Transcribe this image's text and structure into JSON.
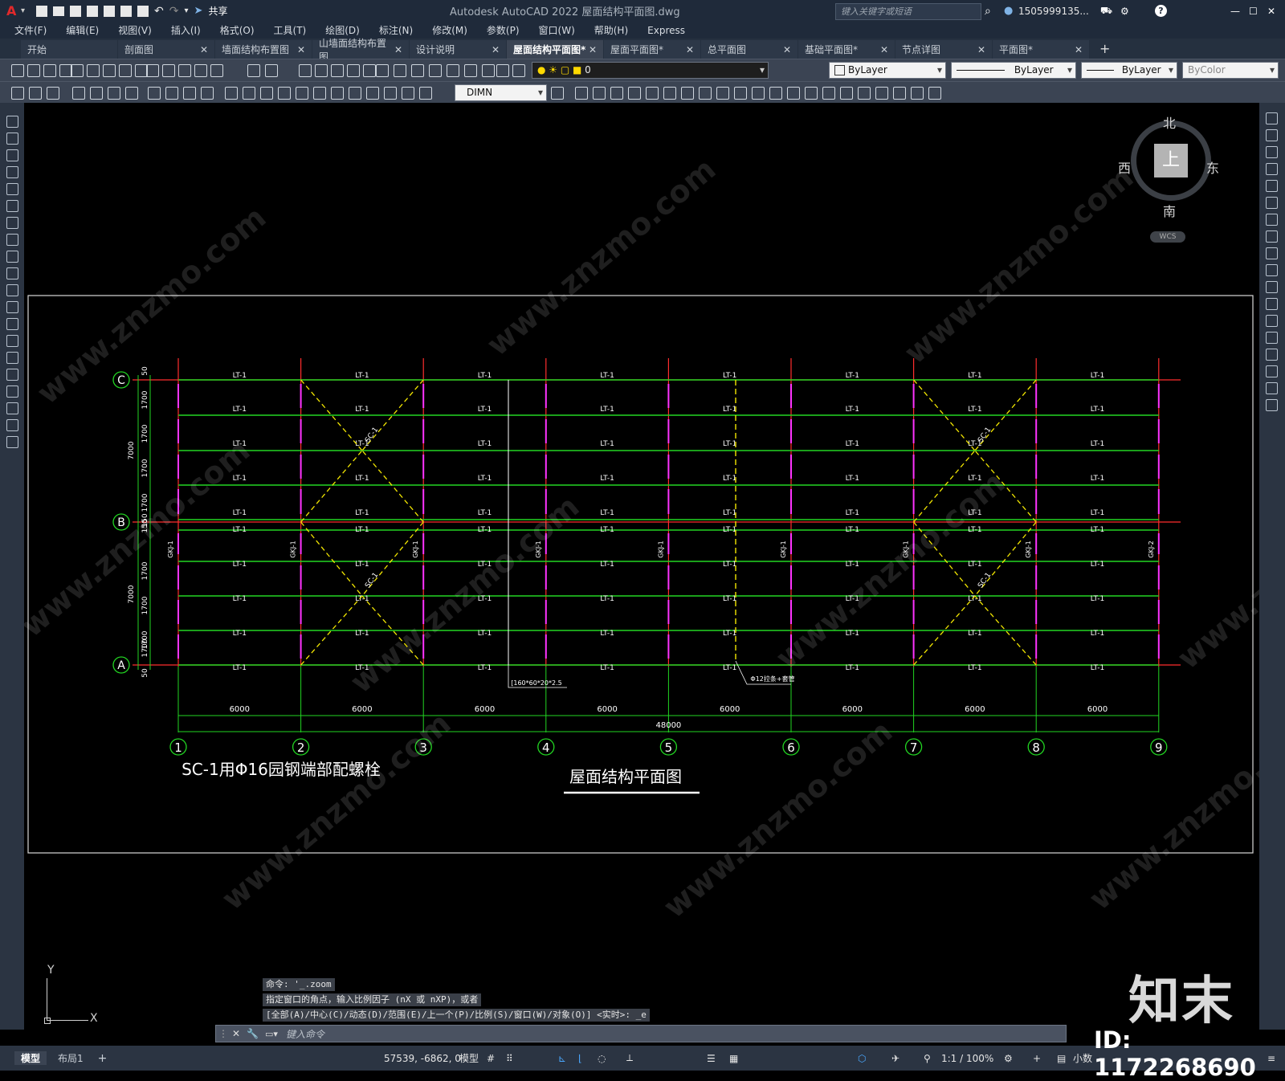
{
  "app": {
    "title": "Autodesk AutoCAD 2022    屋面结构平面图.dwg",
    "search_placeholder": "键入关键字或短语",
    "user": "1505999135...",
    "share": "共享",
    "logo": "A"
  },
  "menu": [
    "文件(F)",
    "编辑(E)",
    "视图(V)",
    "插入(I)",
    "格式(O)",
    "工具(T)",
    "绘图(D)",
    "标注(N)",
    "修改(M)",
    "参数(P)",
    "窗口(W)",
    "帮助(H)",
    "Express"
  ],
  "tabs": [
    {
      "label": "开始",
      "close": ""
    },
    {
      "label": "剖面图",
      "close": "✕"
    },
    {
      "label": "墙面结构布置图",
      "close": "✕"
    },
    {
      "label": "山墙面结构布置图",
      "close": "✕"
    },
    {
      "label": "设计说明",
      "close": "✕"
    },
    {
      "label": "屋面结构平面图*",
      "close": "✕"
    },
    {
      "label": "屋面平面图*",
      "close": "✕"
    },
    {
      "label": "总平面图",
      "close": "✕"
    },
    {
      "label": "基础平面图*",
      "close": "✕"
    },
    {
      "label": "节点详图",
      "close": "✕"
    },
    {
      "label": "平面图*",
      "close": "✕"
    }
  ],
  "active_tab": 5,
  "toolbar": {
    "layer_value": "0",
    "color": "ByLayer",
    "linetype": "ByLayer",
    "lineweight": "ByLayer",
    "plotstyle": "ByColor",
    "dimstyle": "DIMN"
  },
  "viewcube": {
    "north": "北",
    "south": "南",
    "east": "东",
    "west": "西",
    "top": "上",
    "wcs": "WCS"
  },
  "ucs": {
    "y": "Y",
    "x": "X"
  },
  "drawing": {
    "grid_cols": [
      "1",
      "2",
      "3",
      "4",
      "5",
      "6",
      "7",
      "8",
      "9"
    ],
    "grid_rows": [
      "C",
      "B",
      "A"
    ],
    "purlin_label": "LT-1",
    "brace_label": "SC-1",
    "bay_dims": [
      "6000",
      "6000",
      "6000",
      "6000",
      "6000",
      "6000",
      "6000",
      "6000"
    ],
    "total_dim": "48000",
    "left_dims_small": [
      "50",
      "1700",
      "1700",
      "1700",
      "1700",
      "150",
      "150",
      "1700",
      "1700",
      "1700",
      "1700",
      "50"
    ],
    "left_dims_big": [
      "7000",
      "7000"
    ],
    "gj_labels": [
      "GKJ-1",
      "GKJ-1",
      "GKJ-1",
      "GKJ-1",
      "GKJ-1",
      "GKJ-1",
      "GKJ-1",
      "GKJ-1",
      "GKJ-2"
    ],
    "note_tube": "[160*60*20*2.5",
    "note_rod": "Φ12拉条+套管",
    "note_sc": "SC-1用Φ16园钢端部配螺栓",
    "title": "屋面结构平面图"
  },
  "command": {
    "history": [
      "命令: '_.zoom",
      "指定窗口的角点，输入比例因子 (nX 或 nXP)，或者",
      "[全部(A)/中心(C)/动态(D)/范围(E)/上一个(P)/比例(S)/窗口(W)/对象(O)] <实时>: _e"
    ],
    "placeholder": "键入命令"
  },
  "status": {
    "layout_tabs": [
      "模型",
      "布局1"
    ],
    "add_tab": "+",
    "coords": "57539, -6862, 0",
    "mode": "模型",
    "scale": "1:1 / 100%",
    "units": "小数"
  },
  "watermark": {
    "brand": "知末",
    "id": "ID: 1172268690",
    "site": "www.znzmo.com",
    "cn": "知末网"
  }
}
